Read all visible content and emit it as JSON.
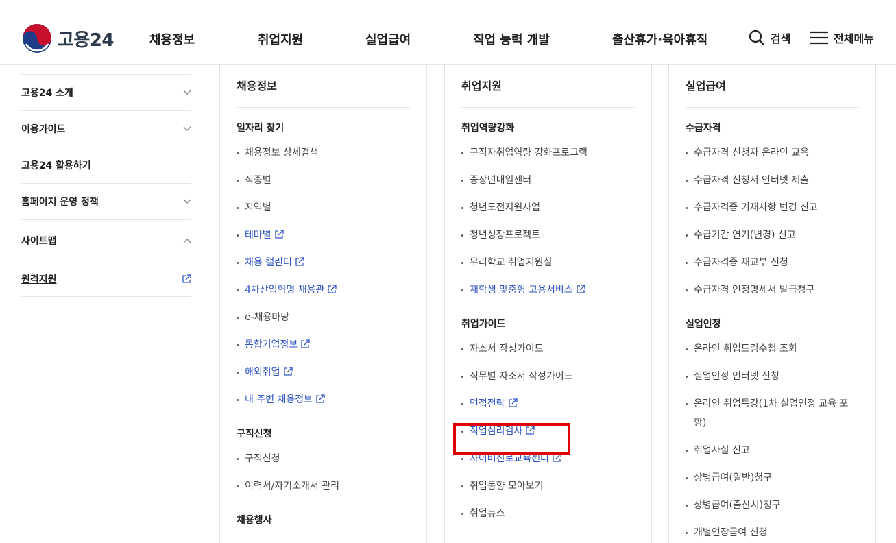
{
  "header": {
    "logo_text": "고용24",
    "nav": [
      "채용정보",
      "취업지원",
      "실업급여",
      "직업 능력 개발",
      "출산휴가·육아휴직"
    ],
    "search_label": "검색",
    "menu_label": "전체메뉴"
  },
  "sidebar": {
    "items": [
      {
        "label": "고용24 소개",
        "chevron": "down"
      },
      {
        "label": "이용가이드",
        "chevron": "down"
      },
      {
        "label": "고용24 활용하기",
        "chevron": ""
      },
      {
        "label": "홈페이지 운영 정책",
        "chevron": "down"
      },
      {
        "label": "사이트맵",
        "chevron": "up"
      }
    ],
    "remote_label": "원격지원"
  },
  "columns": [
    {
      "title": "채용정보",
      "groups": [
        {
          "title": "일자리 찾기",
          "items": [
            {
              "label": "채용정보 상세검색",
              "link": false
            },
            {
              "label": "직종별",
              "link": false
            },
            {
              "label": "지역별",
              "link": false
            },
            {
              "label": "테마별",
              "link": true
            },
            {
              "label": "채용 캘린더",
              "link": true
            },
            {
              "label": "4차산업혁명 채용관",
              "link": true
            },
            {
              "label": "e-채용마당",
              "link": false
            },
            {
              "label": "통합기업정보",
              "link": true
            },
            {
              "label": "해외취업",
              "link": true
            },
            {
              "label": "내 주변 채용정보",
              "link": true
            }
          ]
        },
        {
          "title": "구직신청",
          "items": [
            {
              "label": "구직신청",
              "link": false
            },
            {
              "label": "이력서/자기소개서 관리",
              "link": false
            }
          ]
        },
        {
          "title": "채용행사",
          "items": []
        }
      ]
    },
    {
      "title": "취업지원",
      "groups": [
        {
          "title": "취업역량강화",
          "items": [
            {
              "label": "구직자취업역량 강화프로그램",
              "link": false
            },
            {
              "label": "중장년내일센터",
              "link": false
            },
            {
              "label": "청년도전지원사업",
              "link": false
            },
            {
              "label": "청년성장프로젝트",
              "link": false
            },
            {
              "label": "우리학교 취업지원실",
              "link": false
            },
            {
              "label": "재학생 맞춤형 고용서비스",
              "link": true
            }
          ]
        },
        {
          "title": "취업가이드",
          "items": [
            {
              "label": "자소서 작성가이드",
              "link": false
            },
            {
              "label": "직무별 자소서 작성가이드",
              "link": false
            },
            {
              "label": "면접전략",
              "link": true
            },
            {
              "label": "직업심리검사",
              "link": true
            },
            {
              "label": "사이버진로교육센터",
              "link": true
            },
            {
              "label": "취업동향 모아보기",
              "link": false
            },
            {
              "label": "취업뉴스",
              "link": false
            }
          ]
        }
      ]
    },
    {
      "title": "실업급여",
      "groups": [
        {
          "title": "수급자격",
          "items": [
            {
              "label": "수급자격 신청자 온라인 교육",
              "link": false
            },
            {
              "label": "수급자격 신청서 인터넷 제출",
              "link": false
            },
            {
              "label": "수급자격증 기재사항 변경 신고",
              "link": false
            },
            {
              "label": "수급기간 연기(변경) 신고",
              "link": false
            },
            {
              "label": "수급자격증 재교부 신청",
              "link": false
            },
            {
              "label": "수급자격 인정명세서 발급청구",
              "link": false
            }
          ]
        },
        {
          "title": "실업인정",
          "items": [
            {
              "label": "온라인 취업드림수첩 조회",
              "link": false
            },
            {
              "label": "실업인정 인터넷 신청",
              "link": false
            },
            {
              "label": "온라인 취업특강(1차 실업인정 교육 포함)",
              "link": false,
              "two_line": true
            },
            {
              "label": "취업사실 신고",
              "link": false
            },
            {
              "label": "상병급여(일반)청구",
              "link": false
            },
            {
              "label": "상병급여(출산시)청구",
              "link": false
            },
            {
              "label": "개별연장급여 신청",
              "link": false
            }
          ]
        }
      ]
    }
  ],
  "colors": {
    "link": "#2f54c2",
    "highlight": "#e00000",
    "logo_red": "#c8102e",
    "logo_blue": "#1f3c88"
  }
}
